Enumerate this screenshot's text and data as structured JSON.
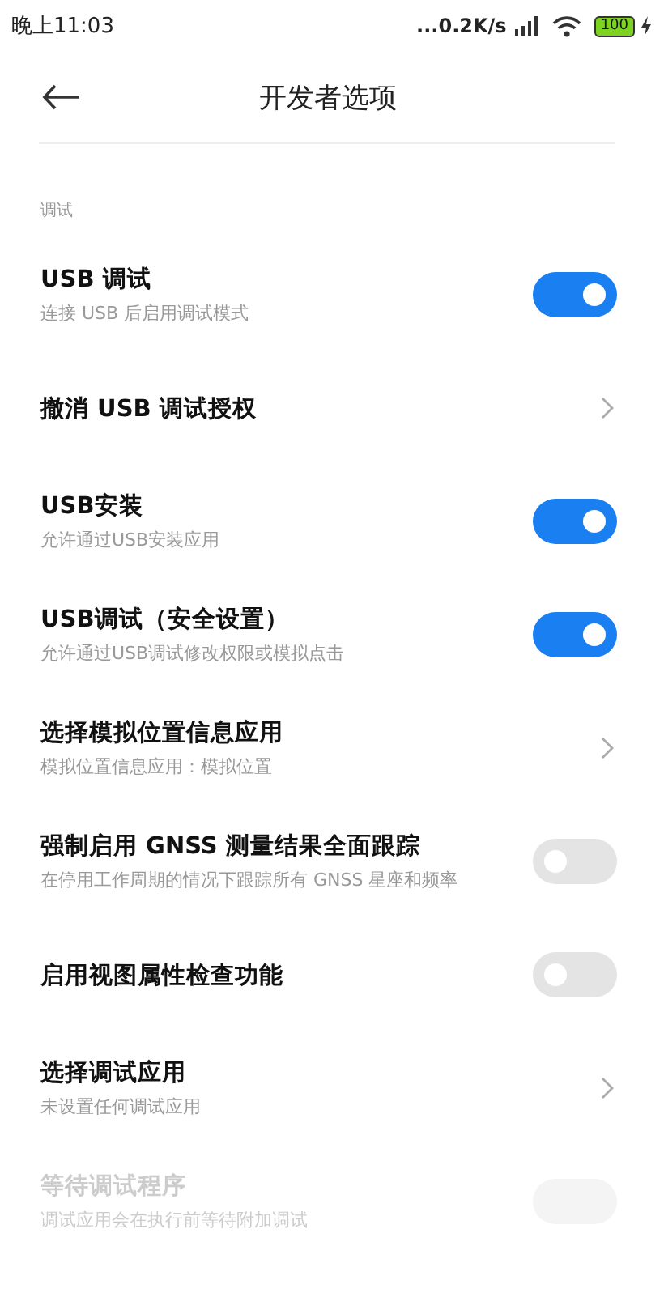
{
  "status_bar": {
    "time": "晚上11:03",
    "speed": "...0.2K/s",
    "battery": "100"
  },
  "header": {
    "title": "开发者选项"
  },
  "section": {
    "label": "调试"
  },
  "items": [
    {
      "kind": "toggle",
      "title": "USB 调试",
      "subtitle": "连接 USB 后启用调试模式",
      "on": true,
      "disabled": false
    },
    {
      "kind": "link",
      "title": "撤消 USB 调试授权",
      "disabled": false
    },
    {
      "kind": "toggle",
      "title": "USB安装",
      "subtitle": "允许通过USB安装应用",
      "on": true,
      "disabled": false
    },
    {
      "kind": "toggle",
      "title": "USB调试（安全设置）",
      "subtitle": "允许通过USB调试修改权限或模拟点击",
      "on": true,
      "disabled": false
    },
    {
      "kind": "link",
      "title": "选择模拟位置信息应用",
      "subtitle": "模拟位置信息应用：模拟位置",
      "disabled": false
    },
    {
      "kind": "toggle",
      "title": "强制启用 GNSS 测量结果全面跟踪",
      "subtitle": "在停用工作周期的情况下跟踪所有 GNSS 星座和频率",
      "on": false,
      "disabled": false
    },
    {
      "kind": "toggle",
      "title": "启用视图属性检查功能",
      "on": false,
      "disabled": false
    },
    {
      "kind": "link",
      "title": "选择调试应用",
      "subtitle": "未设置任何调试应用",
      "disabled": false
    },
    {
      "kind": "toggle",
      "title": "等待调试程序",
      "subtitle": "调试应用会在执行前等待附加调试",
      "on": false,
      "disabled": true
    }
  ]
}
